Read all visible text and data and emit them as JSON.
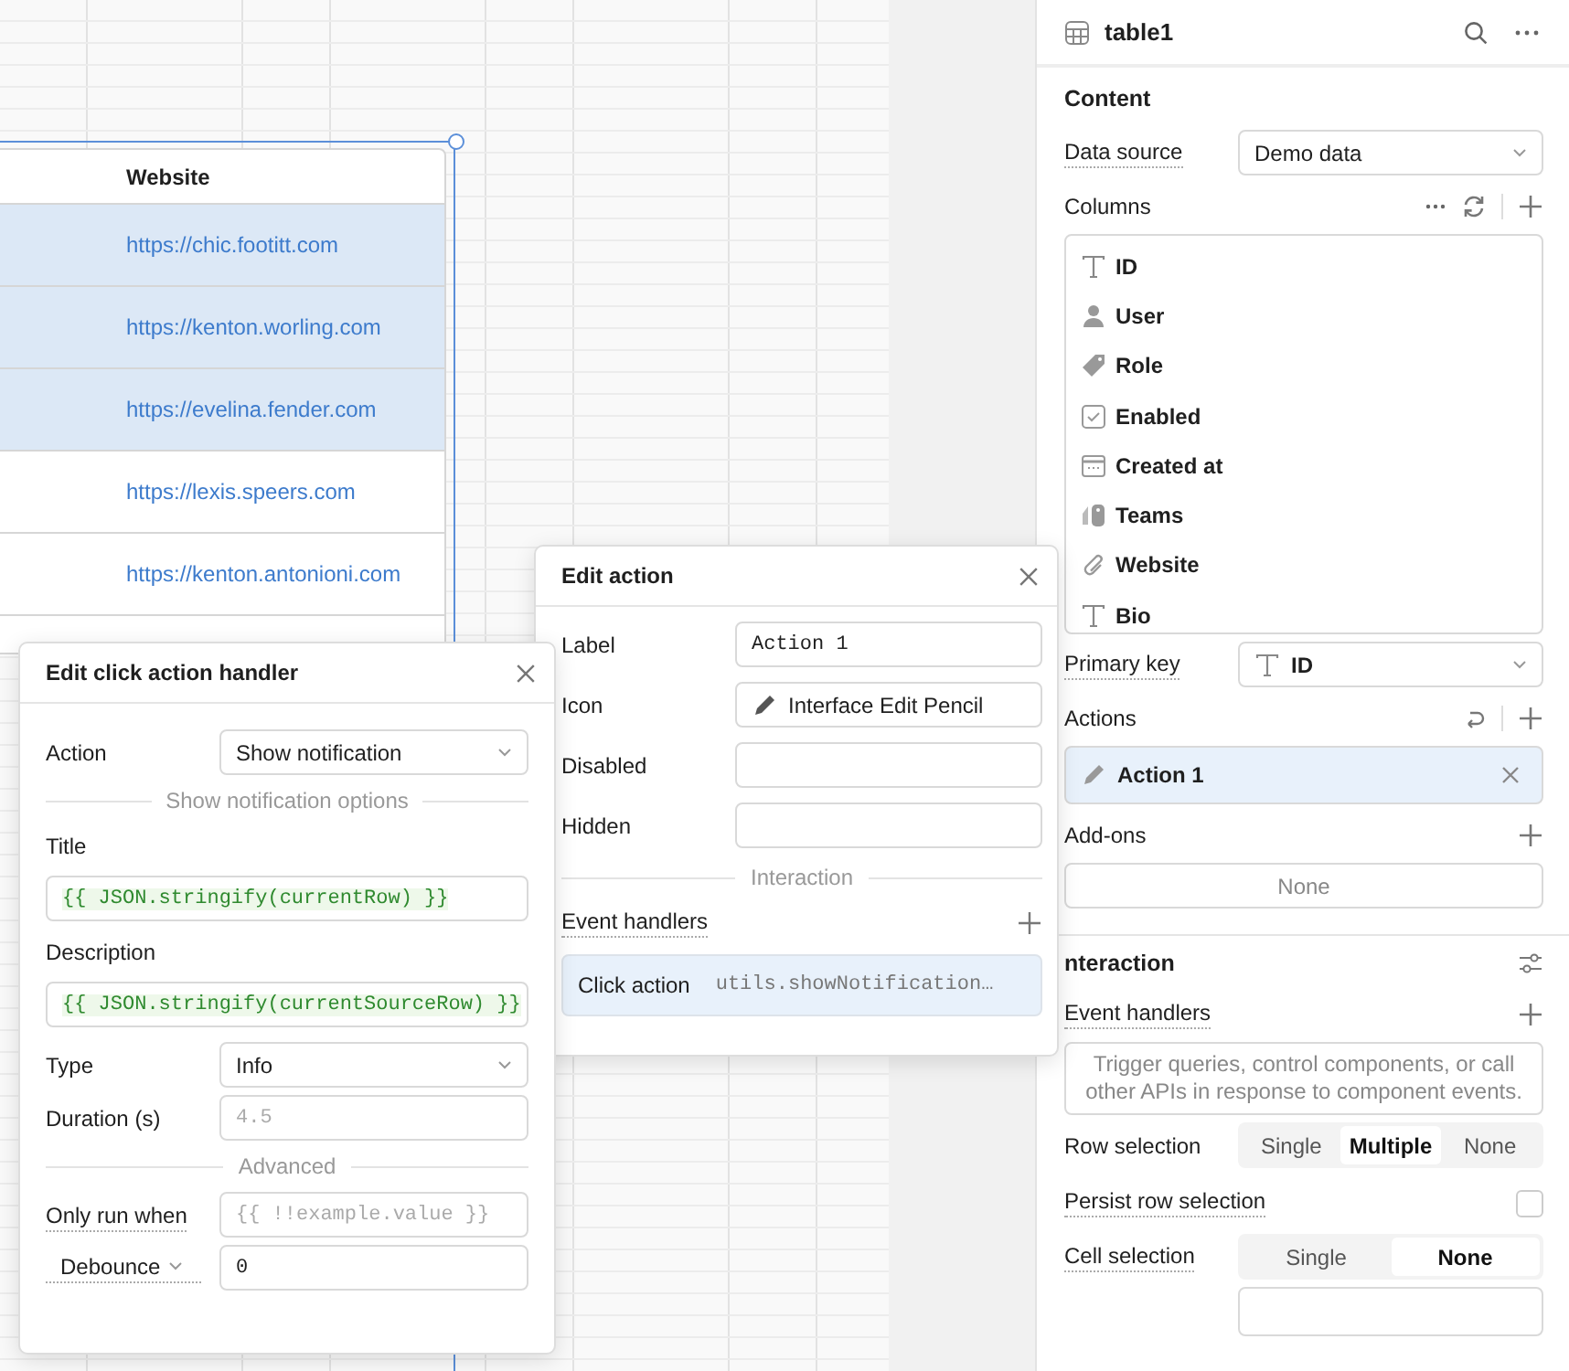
{
  "canvas": {
    "table": {
      "columns": [
        {
          "label": "Website"
        }
      ],
      "rows": [
        {
          "website": "https://chic.footitt.com",
          "selected": true
        },
        {
          "website": "https://kenton.worling.com",
          "selected": true
        },
        {
          "website": "https://evelina.fender.com",
          "selected": true
        },
        {
          "website": "https://lexis.speers.com",
          "selected": false
        },
        {
          "website": "https://kenton.antonioni.com",
          "selected": false
        }
      ]
    }
  },
  "inspector": {
    "title": "table1",
    "content": {
      "heading": "Content",
      "data_source": {
        "label": "Data source",
        "value": "Demo data"
      },
      "columns_label": "Columns",
      "columns": [
        {
          "label": "ID",
          "kind": "text"
        },
        {
          "label": "User",
          "kind": "user"
        },
        {
          "label": "Role",
          "kind": "tag"
        },
        {
          "label": "Enabled",
          "kind": "boolean"
        },
        {
          "label": "Created at",
          "kind": "date"
        },
        {
          "label": "Teams",
          "kind": "tags"
        },
        {
          "label": "Website",
          "kind": "link"
        },
        {
          "label": "Bio",
          "kind": "text"
        }
      ],
      "primary_key": {
        "label": "Primary key",
        "value": "ID"
      },
      "actions_label": "Actions",
      "actions": [
        {
          "label": "Action 1",
          "selected": true
        }
      ],
      "addons_label": "Add-ons",
      "addons_empty": "None"
    },
    "interaction": {
      "heading": "nteraction",
      "event_handlers_label": "Event handlers",
      "event_handlers_placeholder": "Trigger queries, control components, or call other APIs in response to component events.",
      "row_selection": {
        "label": "Row selection",
        "options": [
          {
            "label": "Single",
            "selected": false
          },
          {
            "label": "Multiple",
            "selected": true
          },
          {
            "label": "None",
            "selected": false
          }
        ]
      },
      "persist_row_selection": {
        "label": "Persist row selection",
        "checked": false
      },
      "cell_selection": {
        "label": "Cell selection",
        "options": [
          {
            "label": "Single",
            "selected": false
          },
          {
            "label": "None",
            "selected": true
          }
        ]
      }
    }
  },
  "edit_action": {
    "title": "Edit action",
    "fields": [
      {
        "label": "Label",
        "kind": "code",
        "value": "Action 1"
      },
      {
        "label": "Icon",
        "kind": "icon",
        "value": "Interface Edit Pencil"
      },
      {
        "label": "Disabled",
        "kind": "input"
      },
      {
        "label": "Hidden",
        "kind": "input"
      }
    ],
    "section": "Interaction",
    "event_handlers_label": "Event handlers",
    "handlers": [
      {
        "event": "Click action",
        "action": "utils.showNotification…",
        "selected": true
      }
    ]
  },
  "edit_handler": {
    "title": "Edit click action handler",
    "rows": [
      {
        "kind": "select",
        "label": "Action",
        "value": "Show notification"
      },
      {
        "kind": "divider",
        "label": "Show notification options"
      },
      {
        "kind": "code",
        "label": "Title",
        "value": "{{ JSON.stringify(currentRow) }}"
      },
      {
        "kind": "code",
        "label": "Description",
        "value": "{{ JSON.stringify(currentSourceRow) }}"
      },
      {
        "kind": "select",
        "label": "Type",
        "value": "Info"
      },
      {
        "kind": "input",
        "label": "Duration (s)",
        "placeholder": "4.5",
        "hint": false
      },
      {
        "kind": "divider",
        "label": "Advanced"
      },
      {
        "kind": "input",
        "label": "Only run when",
        "placeholder": "{{ !!example.value }}",
        "hint": true
      },
      {
        "kind": "menu",
        "label": "Debounce",
        "value": "0"
      }
    ]
  }
}
